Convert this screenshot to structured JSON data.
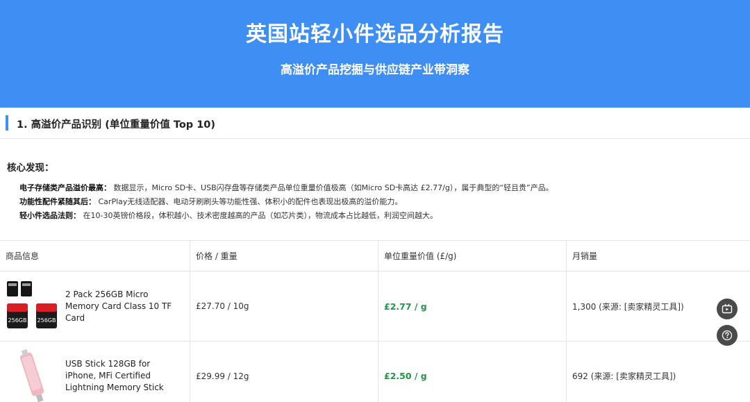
{
  "header": {
    "title": "英国站轻小件选品分析报告",
    "subtitle": "高溢价产品挖掘与供应链产业带洞察"
  },
  "section": {
    "title": "1. 高溢价产品识别 (单位重量价值 Top 10)"
  },
  "findings": {
    "title": "核心发现：",
    "items": [
      {
        "key": "电子存储类产品溢价最高：",
        "text": "数据显示，Micro SD卡、USB闪存盘等存储类产品单位重量价值极高（如Micro SD卡高达 £2.77/g），属于典型的“轻且贵”产品。"
      },
      {
        "key": "功能性配件紧随其后：",
        "text": "CarPlay无线适配器、电动牙刷刷头等功能性强、体积小的配件也表现出极高的溢价能力。"
      },
      {
        "key": "轻小件选品法则：",
        "text": "在10-30英镑价格段，体积越小、技术密度越高的产品（如芯片类），物流成本占比越低，利润空间越大。"
      }
    ]
  },
  "table": {
    "headers": [
      "商品信息",
      "价格 / 重量",
      "单位重量价值 (£/g)",
      "月销量"
    ],
    "rows": [
      {
        "name": "2 Pack 256GB Micro Memory Card Class 10 TF Card",
        "price_weight": "£27.70 / 10g",
        "unit_value": "£2.77 / g",
        "monthly_sales": "1,300 (来源: [卖家精灵工具])",
        "thumb_label": "256GB"
      },
      {
        "name": "USB Stick 128GB for iPhone, MFi Certified Lightning Memory Stick",
        "price_weight": "£29.99 / 12g",
        "unit_value": "£2.50 / g",
        "monthly_sales": "692 (来源: [卖家精灵工具])"
      }
    ]
  },
  "colors": {
    "hero_background": "#3f8ef4",
    "accent_bar": "#3f8ef4",
    "unit_value_text": "#1e9a46",
    "fab_background": "#4a4a4a"
  },
  "icons": {
    "floating_top": "tv-icon",
    "floating_bottom": "help-icon"
  }
}
